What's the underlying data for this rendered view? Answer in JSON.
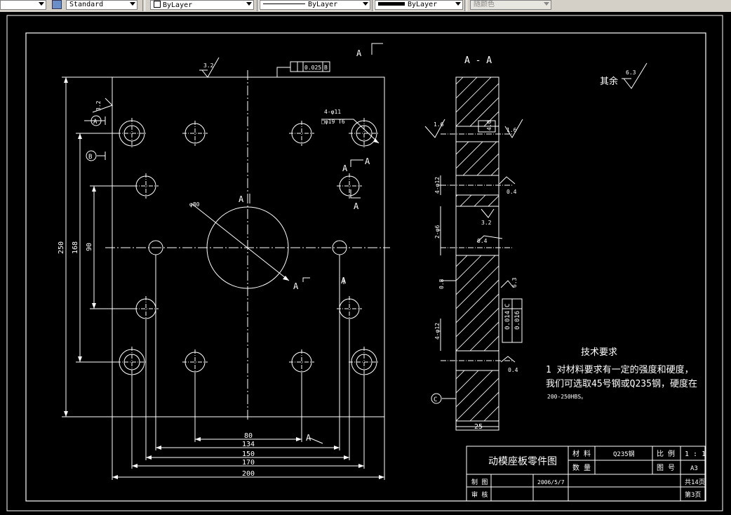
{
  "toolbar": {
    "textstyle": "Standard",
    "layer": "ByLayer",
    "linetype": "ByLayer",
    "lineweight": "ByLayer",
    "color": "随颜色"
  },
  "drawing": {
    "section_label": "A - A",
    "section_marks": {
      "a": "A"
    },
    "labels": {
      "A": "A",
      "B": "B",
      "C": "C"
    },
    "dims": {
      "d250": "250",
      "d168": "168",
      "d90": "90",
      "d80": "80",
      "d134": "134",
      "d150": "150",
      "d170": "170",
      "d200": "200",
      "d25": "25",
      "phi80": "φ80",
      "holes_4": "4-φ11",
      "holes_4b": "□φ19 T6",
      "side_4phi12": "4-φ12",
      "side_2phi": "2-φ6",
      "side_4phi12b": "4-φ12",
      "side_08": "0.8"
    },
    "roughness": {
      "r_top": "3.2",
      "r_left": "3.2",
      "r_rest_value": "6.3",
      "r_s1": "1.6",
      "r_s2": "1.6",
      "r_s3": "0.4",
      "r_s4": "3.2",
      "r_s5": "0.4",
      "r_s6": "6.3",
      "r_s7": "0.4",
      "r_flag": "4.0"
    },
    "tolerance": {
      "flat": "0.025",
      "flat_ref": "B",
      "perp": "0.014",
      "perp_ref": "C",
      "flat2": "0.016"
    },
    "rest": "其余",
    "tech_title": "技术要求",
    "tech_line1": "1  对材料要求有一定的强度和硬度，",
    "tech_line2": "我们可选取45号钢或Q235钢，硬度在",
    "tech_line3": "200-250HBS。"
  },
  "title_block": {
    "title": "动模座板零件图",
    "material_label": "材 料",
    "material": "Q235钢",
    "scale_label": "比 例",
    "scale": "1 : 1",
    "qty_label": "数 量",
    "drawing_no_label": "图 号",
    "drawing_no": "A3",
    "drawn_label": "制 图",
    "date": "2006/5/7",
    "checked_label": "审 核",
    "total_sheets": "共14页",
    "sheet": "第3页"
  }
}
